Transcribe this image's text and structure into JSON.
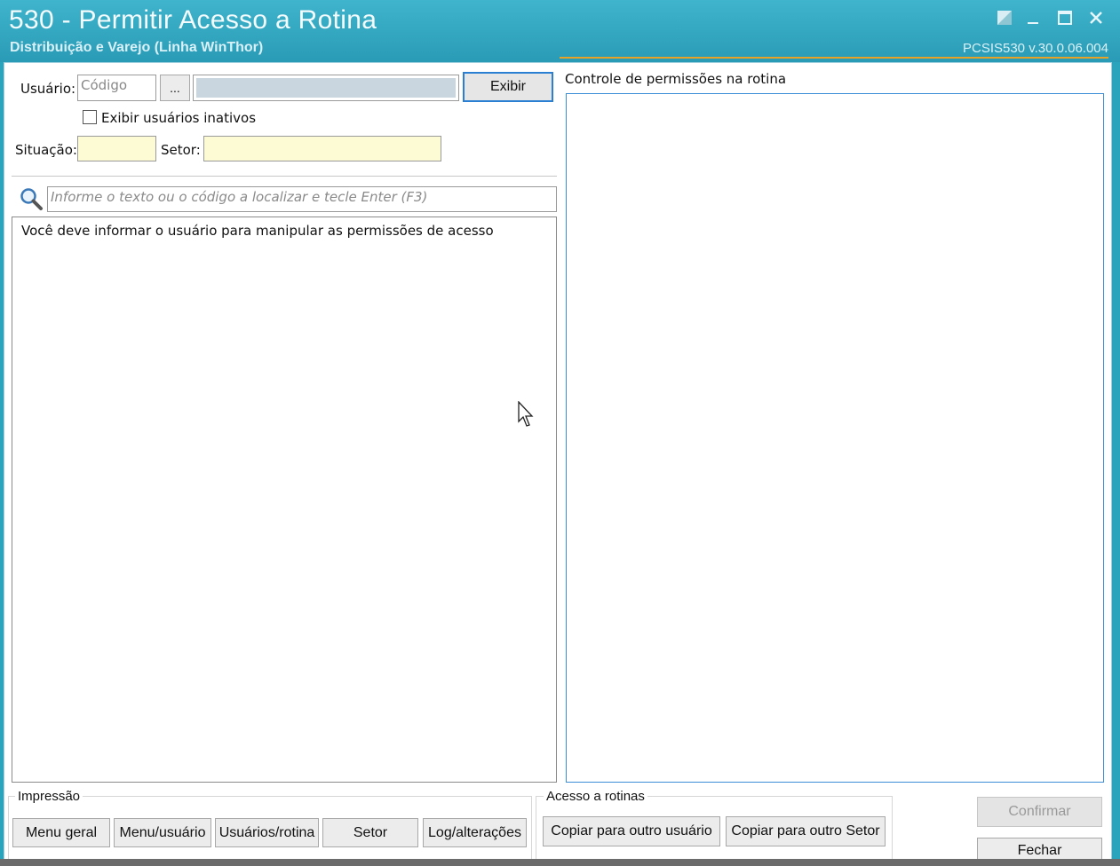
{
  "window": {
    "title": "530 - Permitir Acesso a Rotina",
    "subtitle": "Distribuição e Varejo (Linha WinThor)",
    "version": "PCSIS530  v.30.0.06.004"
  },
  "user_section": {
    "usuario_label": "Usuário:",
    "codigo_placeholder": "Código",
    "ellipsis_label": "...",
    "name_value": "",
    "exibir_label": "Exibir",
    "inactive_checkbox_label": "Exibir usuários inativos",
    "inactive_checked": false,
    "situacao_label": "Situação:",
    "situacao_value": "",
    "setor_label": "Setor:",
    "setor_value": ""
  },
  "search": {
    "placeholder": "Informe o texto ou o código a localizar e tecle Enter (F3)"
  },
  "list": {
    "message": "Você deve informar o usuário para manipular as permissões de acesso"
  },
  "permissions": {
    "title": "Controle de permissões na rotina"
  },
  "impressao": {
    "title": "Impressão",
    "buttons": [
      "Menu geral",
      "Menu/usuário",
      "Usuários/rotina",
      "Setor",
      "Log/alterações"
    ]
  },
  "acesso": {
    "title": "Acesso a rotinas",
    "buttons": [
      "Copiar para outro usuário",
      "Copiar para outro Setor"
    ]
  },
  "actions": {
    "confirmar": "Confirmar",
    "confirmar_enabled": false,
    "fechar": "Fechar"
  },
  "colors": {
    "titlebar": "#2aa3bd",
    "accent_line": "#e8a326",
    "focus_border": "#2a7fd2",
    "readonly_yellow": "#fdfbd4"
  }
}
